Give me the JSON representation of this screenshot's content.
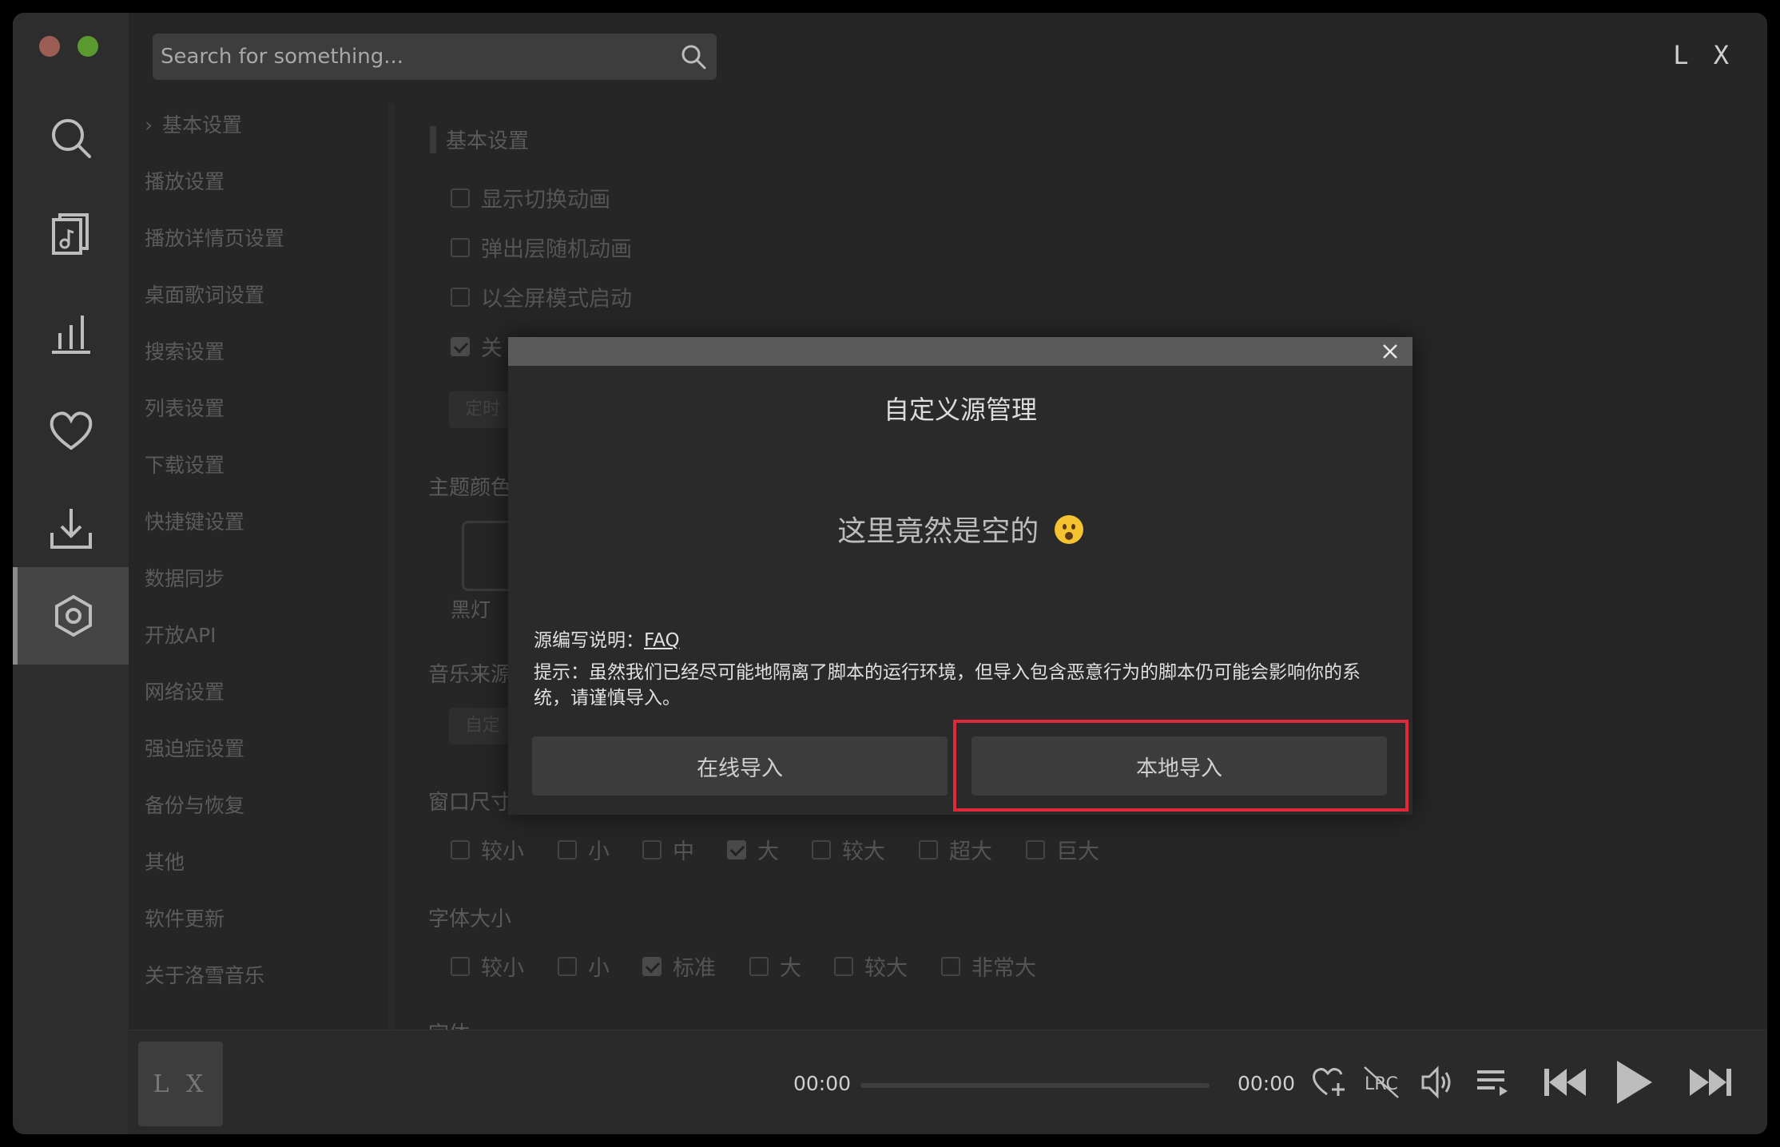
{
  "window": {
    "brand": "L X",
    "search": {
      "placeholder": "Search for something..."
    }
  },
  "rail": {
    "items": [
      {
        "name": "search",
        "icon": "search-icon"
      },
      {
        "name": "song-list",
        "icon": "music-doc-icon"
      },
      {
        "name": "leaderboard",
        "icon": "bar-chart-icon"
      },
      {
        "name": "favorites",
        "icon": "heart-icon"
      },
      {
        "name": "downloads",
        "icon": "download-icon"
      },
      {
        "name": "settings",
        "icon": "settings-icon",
        "active": true
      }
    ]
  },
  "settings_menu": {
    "items": [
      "基本设置",
      "播放设置",
      "播放详情页设置",
      "桌面歌词设置",
      "搜索设置",
      "列表设置",
      "下载设置",
      "快捷键设置",
      "数据同步",
      "开放API",
      "网络设置",
      "强迫症设置",
      "备份与恢复",
      "其他",
      "软件更新",
      "关于洛雪音乐"
    ]
  },
  "content": {
    "section_basic": "基本设置",
    "options": [
      "显示切换动画",
      "弹出层随机动画",
      "以全屏模式启动",
      "关"
    ],
    "timer_btn": "定时",
    "theme_title": "主题颜色",
    "theme_label": "黑灯",
    "source_title": "音乐来源",
    "source_btn": "自定",
    "window_size": {
      "title": "窗口尺寸",
      "options": [
        "较小",
        "小",
        "中",
        "大",
        "较大",
        "超大",
        "巨大"
      ],
      "checked": "大"
    },
    "font_size": {
      "title": "字体大小",
      "options": [
        "较小",
        "小",
        "标准",
        "大",
        "较大",
        "非常大"
      ],
      "checked": "标准"
    },
    "font_title": "字体"
  },
  "modal": {
    "title": "自定义源管理",
    "empty_text": "这里竟然是空的",
    "empty_emoji": "hushed-face-emoji",
    "note_label": "源编写说明：",
    "note_link": "FAQ",
    "hint": "提示：虽然我们已经尽可能地隔离了脚本的运行环境，但导入包含恶意行为的脚本仍可能会影响你的系统，请谨慎导入。",
    "btn_online": "在线导入",
    "btn_local": "本地导入"
  },
  "player": {
    "cover_text": "L X",
    "time_current": "00:00",
    "time_total": "00:00",
    "progress": 0,
    "controls": [
      "add-favorite-icon",
      "lyrics-icon",
      "volume-icon",
      "playlist-icon",
      "previous-icon",
      "play-icon",
      "next-icon"
    ],
    "lrc_label": "LRC"
  },
  "colors": {
    "highlight": "#e0283a",
    "light_red": "#9c5d55",
    "light_green": "#5a9a2e"
  }
}
